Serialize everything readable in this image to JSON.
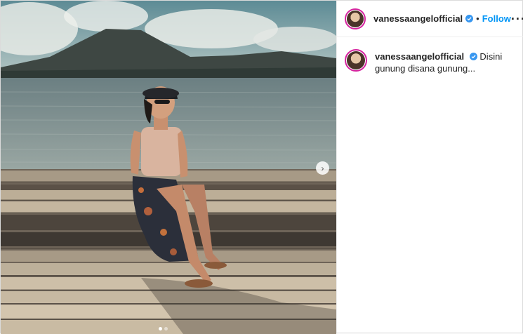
{
  "post": {
    "username": "vanessaangelofficial",
    "verified": true,
    "follow_label": "Follow",
    "separator": "•",
    "more_label": "···",
    "caption": "Disini gunung disana gunung...",
    "carousel_slides": 2,
    "current_slide": 1,
    "next_label": "›"
  },
  "colors": {
    "accent": "#0095f6",
    "text": "#262626",
    "border": "#dbdbdb"
  }
}
